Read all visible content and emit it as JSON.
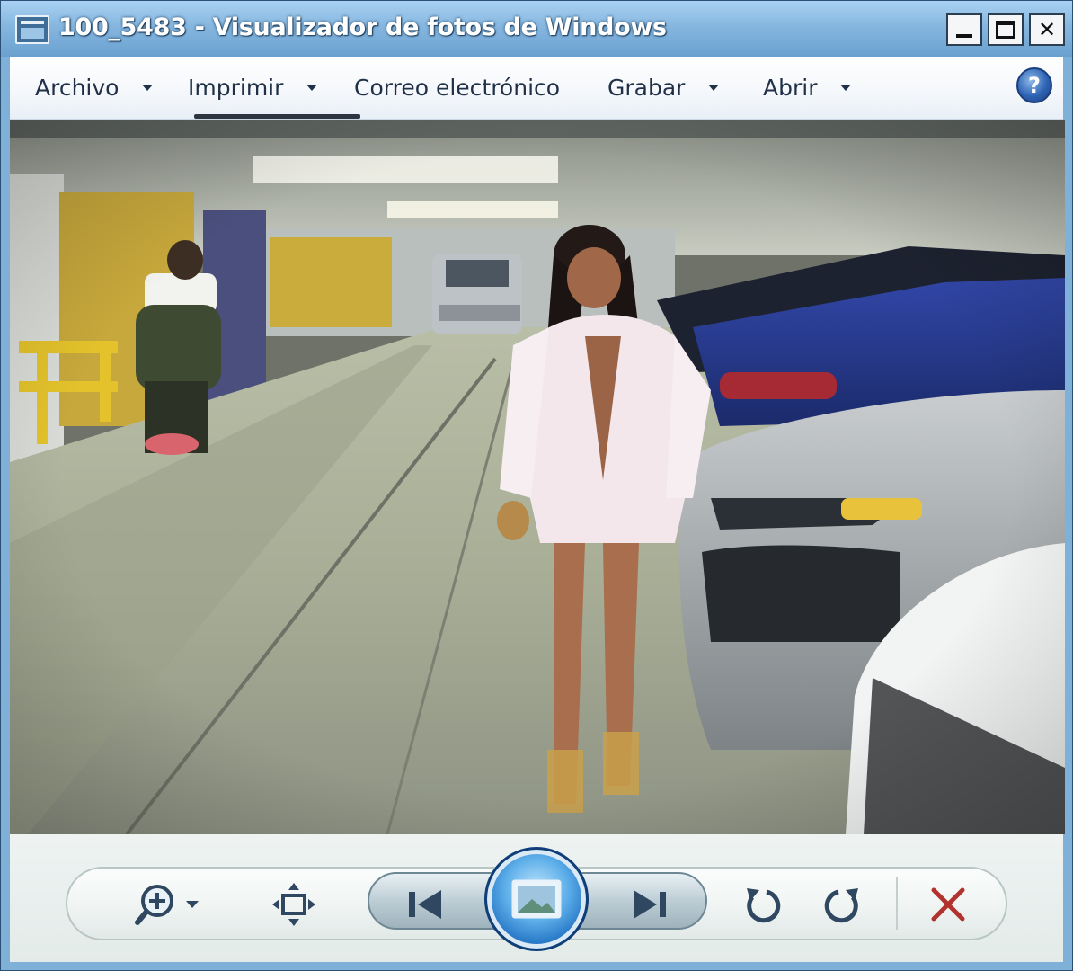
{
  "window": {
    "title": "100_5483 - Visualizador de fotos de Windows",
    "minimize_label": "_",
    "close_label": "✕"
  },
  "menu": {
    "items": [
      {
        "label": "Archivo",
        "has_dropdown": true
      },
      {
        "label": "Imprimir",
        "has_dropdown": true
      },
      {
        "label": "Correo electrónico",
        "has_dropdown": false
      },
      {
        "label": "Grabar",
        "has_dropdown": true
      },
      {
        "label": "Abrir",
        "has_dropdown": true
      }
    ],
    "help_label": "?"
  },
  "toolbar": {
    "icons": {
      "zoom": "zoom-in-icon",
      "fit": "actual-size-icon",
      "previous": "previous-icon",
      "slideshow": "slideshow-icon",
      "next": "next-icon",
      "rotate_left": "rotate-counterclockwise-icon",
      "rotate_right": "rotate-clockwise-icon",
      "delete": "delete-icon"
    },
    "colors": {
      "glyph": "#2f4760",
      "delete": "#b2332d",
      "slideshow": "#1e6fc1"
    }
  }
}
